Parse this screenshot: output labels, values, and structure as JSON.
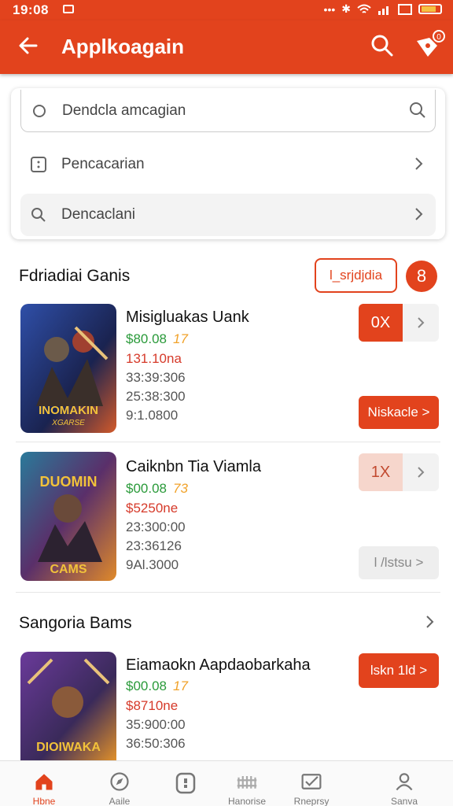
{
  "status": {
    "time": "19:08"
  },
  "appbar": {
    "title": "Applkoagain"
  },
  "search": {
    "field_placeholder": "Dendcla amcagian",
    "row2_label": "Pencacarian",
    "row3_label": "Dencaclani"
  },
  "section1": {
    "title": "Fdriadiai Ganis",
    "outline_button": "l_srjdjdia",
    "round_button": "8"
  },
  "games": [
    {
      "name": "Misigluakas Uank",
      "price": "$80.08",
      "badge": "17",
      "line2": "131.10na",
      "line3": "33:39:306",
      "line4": "25:38:300",
      "line5": "9:1.0800",
      "thumb_text": "INOMAKIN",
      "thumb_sub": "XGARSE",
      "qty": "0X",
      "action": "Niskacle >",
      "colors": [
        "#3a4d9a",
        "#d35a2a"
      ]
    },
    {
      "name": "Caiknbn Tia Viamla",
      "price": "$00.08",
      "badge": "73",
      "line2": "$5250ne",
      "line3": "23:300:00",
      "line4": "23:36126",
      "line5": "9Al.3000",
      "thumb_text": "DUOMIN",
      "thumb_sub": "CAMS",
      "qty": "1X",
      "action": "l /lstsu >",
      "colors": [
        "#7a3f7a",
        "#e08a2a"
      ]
    }
  ],
  "section2": {
    "title": "Sangoria Bams"
  },
  "game3": {
    "name": "Eiamaokn Aapdaobarkaha",
    "price": "$00.08",
    "badge": "17",
    "line2": "$8710ne",
    "line3": "35:900:00",
    "line4": "36:50:306",
    "thumb_text": "DIOIWAKA",
    "action": "lskn 1ld >",
    "colors": [
      "#5a3a8a",
      "#e0902a"
    ]
  },
  "nav": {
    "items": [
      {
        "label": "Hbne",
        "icon": "home-icon"
      },
      {
        "label": "Aaile",
        "icon": "compass-icon"
      },
      {
        "label": "",
        "icon": "pad-icon"
      },
      {
        "label": "Hanorise",
        "icon": "fence-icon"
      },
      {
        "label": "Rneprsy",
        "icon": "message-icon"
      },
      {
        "label": "Sanva",
        "icon": "profile-icon"
      }
    ]
  },
  "colors": {
    "accent": "#e2431d",
    "price_green": "#2a9a3a",
    "sale_red": "#d63a2a"
  }
}
